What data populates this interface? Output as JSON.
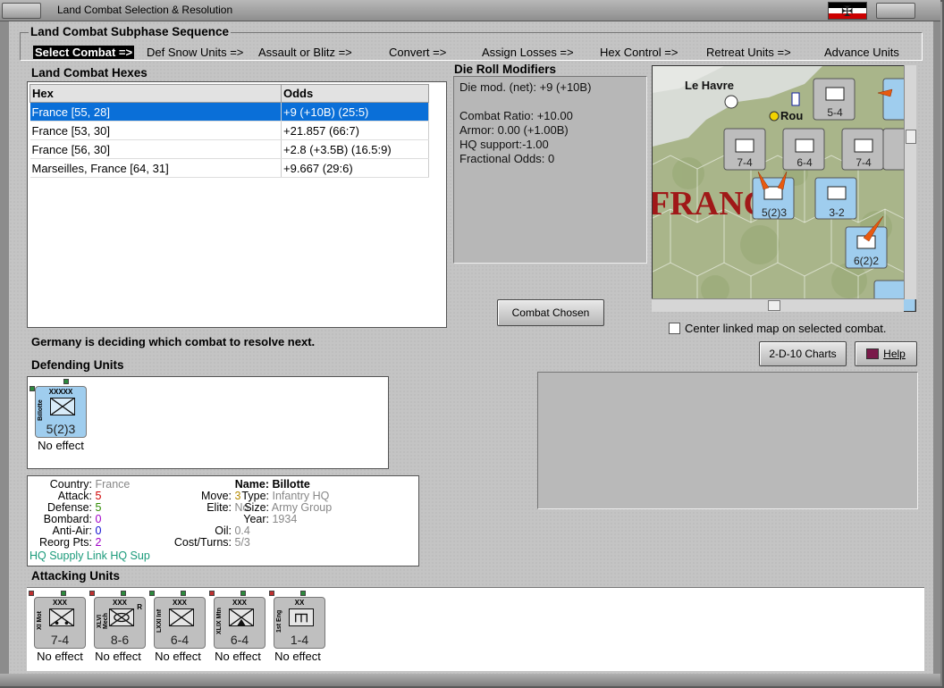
{
  "window": {
    "title": "Land Combat Selection & Resolution"
  },
  "subphase": {
    "title": "Land Combat Subphase Sequence",
    "steps": [
      "Select Combat =>",
      "Def Snow Units =>",
      "Assault or Blitz =>",
      "Convert =>",
      "Assign Losses =>",
      "Hex Control =>",
      "Retreat Units =>",
      "Advance Units"
    ]
  },
  "hexes": {
    "title": "Land Combat Hexes",
    "headers": [
      "Hex",
      "Odds"
    ],
    "rows": [
      {
        "hex": "France [55, 28]",
        "odds": "+9 (+10B) (25:5)"
      },
      {
        "hex": "France [53, 30]",
        "odds": "+21.857 (66:7)"
      },
      {
        "hex": "France [56, 30]",
        "odds": "+2.8 (+3.5B) (16.5:9)"
      },
      {
        "hex": "Marseilles, France [64, 31]",
        "odds": "+9.667 (29:6)"
      }
    ]
  },
  "die_roll": {
    "title": "Die Roll Modifiers",
    "lines": [
      "Die mod. (net): +9 (+10B)",
      "",
      "Combat Ratio: +10.00",
      "Armor: 0.00 (+1.00B)",
      "HQ support:-1.00",
      "Fractional Odds: 0"
    ]
  },
  "buttons": {
    "combat_chosen": "Combat Chosen",
    "charts": "2-D-10 Charts",
    "help": "Help"
  },
  "map": {
    "labels": {
      "city1": "Le Havre",
      "city2": "Rou",
      "region": "FRANC"
    },
    "center_checkbox_label": "Center linked map on selected combat.",
    "center_checked": false
  },
  "status": "Germany is deciding which combat to resolve next.",
  "defending": {
    "title": "Defending Units",
    "units": [
      {
        "size": "XXXXX",
        "name": "Billotte",
        "strength": "5(2)3",
        "result": "No effect",
        "color": "#9fcdee"
      }
    ]
  },
  "details": {
    "country_label": "Country:",
    "country": "France",
    "attack_label": "Attack:",
    "attack": "5",
    "defense_label": "Defense:",
    "defense": "5",
    "bombard_label": "Bombard:",
    "bombard": "0",
    "antiair_label": "Anti-Air:",
    "antiair": "0",
    "reorg_label": "Reorg Pts:",
    "reorg": "2",
    "move_label": "Move:",
    "move": "3",
    "elite_label": "Elite:",
    "elite": "No",
    "oil_label": "Oil:",
    "oil": "0.4",
    "cost_label": "Cost/Turns:",
    "cost": "5/3",
    "name_label": "Name:",
    "name": "Billotte",
    "type_label": "Type:",
    "type": "Infantry HQ",
    "size_label": "Size:",
    "size": "Army Group",
    "year_label": "Year:",
    "year": "1934",
    "supply": "HQ Supply Link HQ Sup"
  },
  "attacking": {
    "title": "Attacking Units",
    "units": [
      {
        "size": "XXX",
        "name": "XI Mot",
        "strength": "7-4",
        "result": "No effect",
        "symbol": "motorized"
      },
      {
        "size": "XXX",
        "name": "XLVI Mech",
        "strength": "8-6",
        "result": "No effect",
        "symbol": "mech",
        "badge": "R"
      },
      {
        "size": "XXX",
        "name": "LXXI Inf",
        "strength": "6-4",
        "result": "No effect",
        "symbol": "infantry"
      },
      {
        "size": "XXX",
        "name": "XLIX Mtn",
        "strength": "6-4",
        "result": "No effect",
        "symbol": "mountain"
      },
      {
        "size": "XX",
        "name": "1st Eng",
        "strength": "1-4",
        "result": "No effect",
        "symbol": "engineer"
      }
    ]
  }
}
